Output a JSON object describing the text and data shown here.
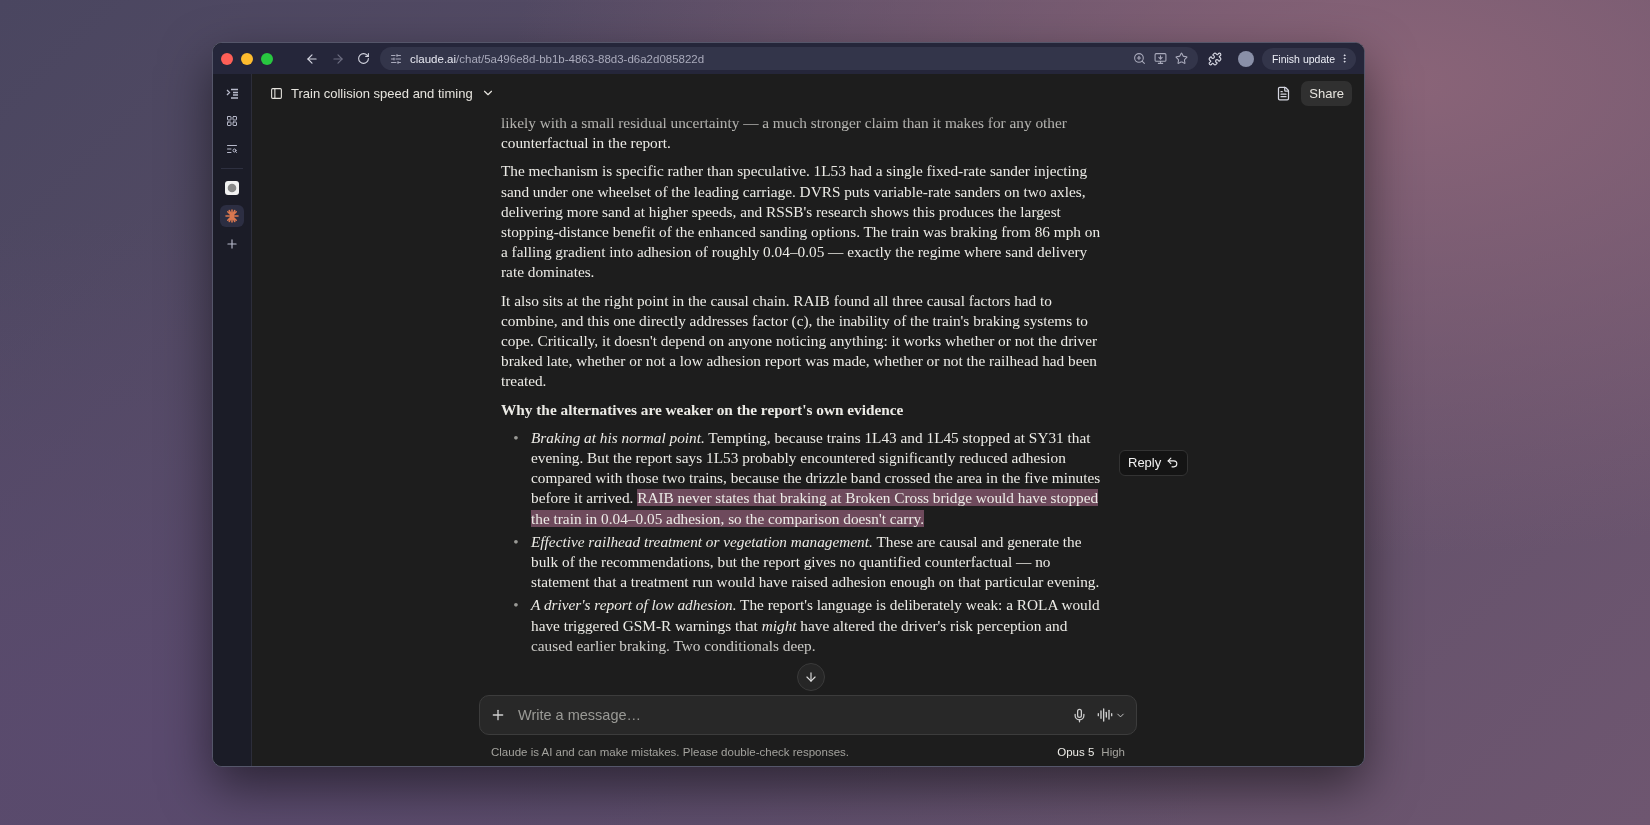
{
  "browser": {
    "url_host": "claude.ai",
    "url_path": "/chat/5a496e8d-bb1b-4863-88d3-d6a2d085822d",
    "forward_disabled": true,
    "update_button": "Finish update"
  },
  "sidebar": {
    "apps": [
      {
        "kind": "app",
        "selected": false
      },
      {
        "kind": "claude",
        "selected": true
      }
    ]
  },
  "header": {
    "title": "Train collision speed and timing",
    "share": "Share"
  },
  "message": {
    "blocks": [
      {
        "kind": "paragraph",
        "text": "likely with a small residual uncertainty — a much stronger claim than it makes for any other counterfactual in the report."
      },
      {
        "kind": "paragraph",
        "text": "The mechanism is specific rather than speculative. 1L53 had a single fixed-rate sander injecting sand under one wheelset of the leading carriage. DVRS puts variable-rate sanders on two axles, delivering more sand at higher speeds, and RSSB's research shows this produces the largest stopping-distance benefit of the enhanced sanding options. The train was braking from 86 mph on a falling gradient into adhesion of roughly 0.04–0.05 — exactly the regime where sand delivery rate dominates."
      },
      {
        "kind": "paragraph",
        "text": "It also sits at the right point in the causal chain. RAIB found all three causal factors had to combine, and this one directly addresses factor (c), the inability of the train's braking systems to cope. Critically, it doesn't depend on anyone noticing anything: it works whether or not the driver braked late, whether or not a low adhesion report was made, whether or not the railhead had been treated."
      },
      {
        "kind": "heading",
        "text": "Why the alternatives are weaker on the report's own evidence"
      },
      {
        "kind": "bullets",
        "items": [
          {
            "marker": "•",
            "lead": "Braking at his normal point.",
            "text": "Tempting, because trains 1L43 and 1L45 stopped at SY31 that evening. But the report says 1L53 probably encountered significantly reduced adhesion compared with those two trains, because the drizzle band crossed the area in the five minutes before it arrived.",
            "selection": "RAIB never states that braking at Broken Cross bridge would have stopped the train in 0.04–0.05 adhesion, so the comparison doesn't carry."
          },
          {
            "marker": "•",
            "lead": "Effective railhead treatment or vegetation management.",
            "text": "These are causal and generate the bulk of the recommendations, but the report gives no quantified counterfactual — no statement that a treatment run would have raised adhesion enough on that particular evening."
          },
          {
            "marker": "•",
            "lead": "A driver's report of low adhesion.",
            "text": "The report's language is deliberately weak: a ROLA would have triggered GSM-R warnings that *might* have altered the driver's risk perception and caused earlier braking. Two conditionals deep."
          }
        ]
      }
    ]
  },
  "reply_popup": "Reply",
  "composer": {
    "placeholder": "Write a message…"
  },
  "footer": {
    "disclaimer": "Claude is AI and can make mistakes. Please double-check responses.",
    "model": "Opus 5",
    "effort": "High"
  }
}
